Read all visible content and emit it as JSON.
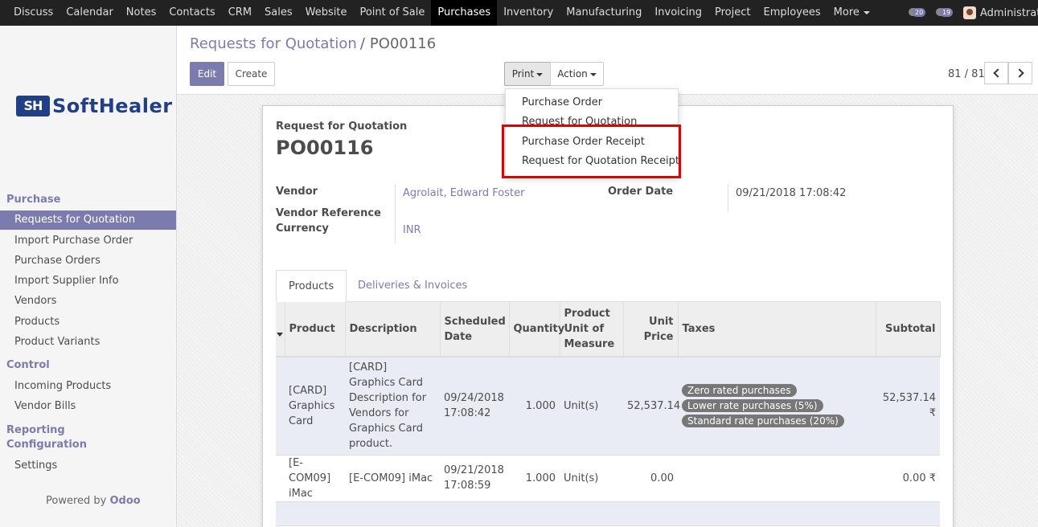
{
  "topbar": {
    "menu": [
      "Discuss",
      "Calendar",
      "Notes",
      "Contacts",
      "CRM",
      "Sales",
      "Website",
      "Point of Sale",
      "Purchases",
      "Inventory",
      "Manufacturing",
      "Invoicing",
      "Project",
      "Employees",
      "More"
    ],
    "active": "Purchases",
    "activity_count": "20",
    "message_count": "19",
    "user": "Administrator"
  },
  "sidebar": {
    "logo_mark": "SH",
    "logo_text": "SoftHealer",
    "sections": [
      {
        "title": "Purchase",
        "items": [
          "Requests for Quotation",
          "Import Purchase Order",
          "Purchase Orders",
          "Import Supplier Info",
          "Vendors",
          "Products",
          "Product Variants"
        ]
      },
      {
        "title": "Control",
        "items": [
          "Incoming Products",
          "Vendor Bills"
        ]
      },
      {
        "title": "Reporting",
        "items": []
      },
      {
        "title": "Configuration",
        "items": [
          "Settings"
        ]
      }
    ],
    "active_item": "Requests for Quotation",
    "powered_prefix": "Powered by",
    "powered_brand": "Odoo"
  },
  "control_panel": {
    "breadcrumb_parent": "Requests for Quotation",
    "breadcrumb_sep": "/",
    "breadcrumb_current": "PO00116",
    "edit_label": "Edit",
    "create_label": "Create",
    "print_label": "Print",
    "action_label": "Action",
    "pager": "81 / 81"
  },
  "print_menu": {
    "items": [
      "Purchase Order",
      "Request for Quotation",
      "Purchase Order Receipt",
      "Request for Quotation Receipt"
    ],
    "highlighted": [
      "Purchase Order Receipt",
      "Request for Quotation Receipt"
    ]
  },
  "form": {
    "subtitle": "Request for Quotation",
    "title": "PO00116",
    "vendor_label": "Vendor",
    "vendor_value": "Agrolait, Edward Foster",
    "vendor_ref_label": "Vendor Reference",
    "currency_label": "Currency",
    "currency_value": "INR",
    "order_date_label": "Order Date",
    "order_date_value": "09/21/2018 17:08:42",
    "tabs": [
      "Products",
      "Deliveries & Invoices"
    ],
    "columns": [
      "Product",
      "Description",
      "Scheduled Date",
      "Quantity",
      "Product Unit of Measure",
      "Unit Price",
      "Taxes",
      "Subtotal"
    ],
    "lines": [
      {
        "product": "[CARD] Graphics Card",
        "description": "[CARD] Graphics Card Description for Vendors for Graphics Card product.",
        "scheduled_date": "09/24/2018 17:08:42",
        "quantity": "1.000",
        "uom": "Unit(s)",
        "unit_price": "52,537.14",
        "taxes": [
          "Zero rated purchases",
          "Lower rate purchases (5%)",
          "Standard rate purchases (20%)"
        ],
        "subtotal": "52,537.14 ₹"
      },
      {
        "product": "[E-COM09] iMac",
        "description": "[E-COM09] iMac",
        "scheduled_date": "09/21/2018 17:08:59",
        "quantity": "1.000",
        "uom": "Unit(s)",
        "unit_price": "0.00",
        "taxes": [],
        "subtotal": "0.00 ₹"
      }
    ]
  },
  "colors": {
    "accent": "#7c7bad",
    "topbar": "#222222",
    "highlight_box": "#e00000"
  }
}
